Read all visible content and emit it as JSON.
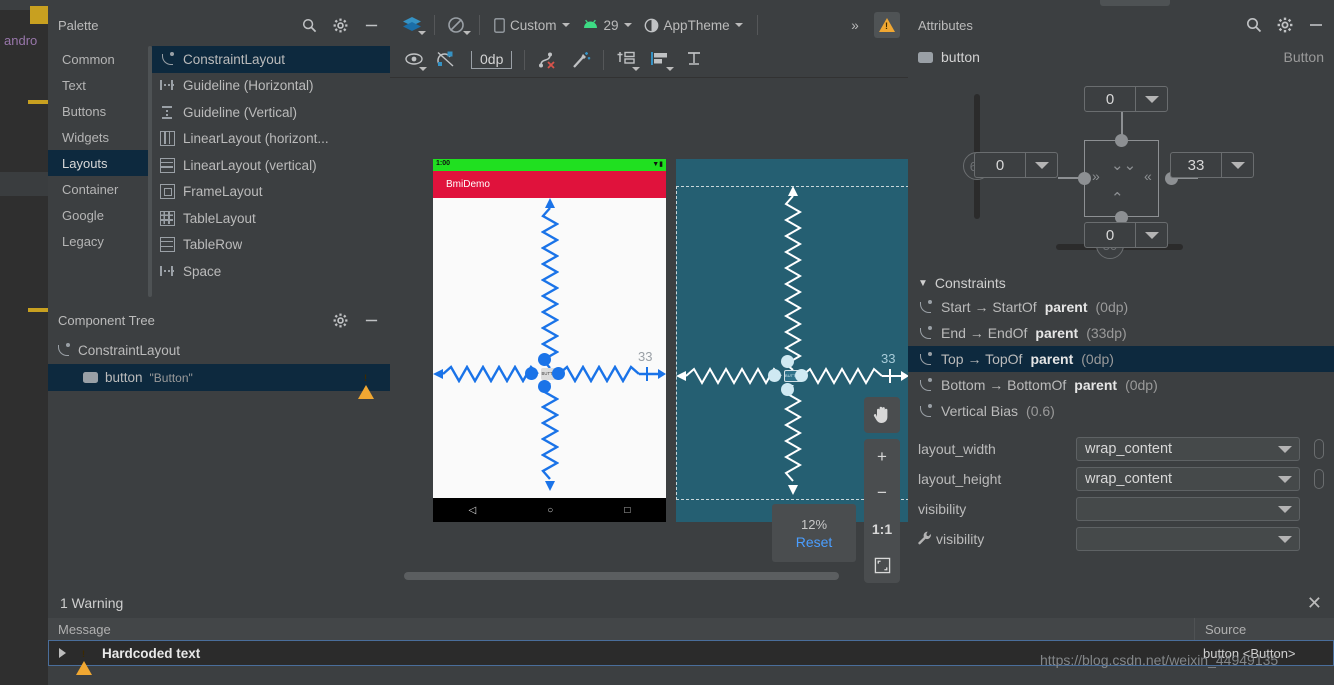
{
  "palette": {
    "title": "Palette",
    "icons": [
      "search-icon",
      "gear-icon",
      "minimize-icon"
    ],
    "categories": [
      {
        "label": "Common",
        "selected": false
      },
      {
        "label": "Text",
        "selected": false
      },
      {
        "label": "Buttons",
        "selected": false
      },
      {
        "label": "Widgets",
        "selected": false
      },
      {
        "label": "Layouts",
        "selected": true
      },
      {
        "label": "Container",
        "selected": false
      },
      {
        "label": "Google",
        "selected": false
      },
      {
        "label": "Legacy",
        "selected": false
      }
    ],
    "items": [
      {
        "label": "ConstraintLayout",
        "icon": "constraint-layout-icon",
        "selected": true
      },
      {
        "label": "Guideline (Horizontal)",
        "icon": "guideline-horizontal-icon",
        "selected": false
      },
      {
        "label": "Guideline (Vertical)",
        "icon": "guideline-vertical-icon",
        "selected": false
      },
      {
        "label": "LinearLayout (horizont...",
        "icon": "linearlayout-horizontal-icon",
        "selected": false
      },
      {
        "label": "LinearLayout (vertical)",
        "icon": "linearlayout-vertical-icon",
        "selected": false
      },
      {
        "label": "FrameLayout",
        "icon": "framelayout-icon",
        "selected": false
      },
      {
        "label": "TableLayout",
        "icon": "tablelayout-icon",
        "selected": false
      },
      {
        "label": "TableRow",
        "icon": "tablerow-icon",
        "selected": false
      },
      {
        "label": "Space",
        "icon": "space-icon",
        "selected": false
      }
    ]
  },
  "component_tree": {
    "title": "Component Tree",
    "nodes": [
      {
        "label": "ConstraintLayout",
        "detail": "",
        "selected": false,
        "warning": false
      },
      {
        "label": "button",
        "detail": "\"Button\"",
        "selected": true,
        "warning": true
      }
    ]
  },
  "design_toolbar": {
    "design_mode_label": "design-surface-mode",
    "orientation_label": "orientation-icon",
    "device": "Custom",
    "api_level": "29",
    "theme": "AppTheme",
    "overflow": "»",
    "warning_count_icon": "warning-icon"
  },
  "constraint_toolbar": {
    "buttons": [
      "show-constraints-icon",
      "autoconnect-icon",
      "default-margin",
      "clear-constraints-icon",
      "infer-constraints-icon",
      "pack-icon",
      "align-icon",
      "guidelines-icon"
    ],
    "default_margin_value": "0dp"
  },
  "canvas": {
    "app_title": "BmiDemo",
    "status_clock": "1:00",
    "status_icons": "▼▮",
    "widget_label": "BUTTON",
    "margin_label_design": "33",
    "margin_label_blueprint": "33",
    "nav_back": "◁",
    "nav_home": "○",
    "nav_recents": "□",
    "zoom_percent": "12%",
    "zoom_reset": "Reset",
    "zoom_buttons": [
      "pan-icon",
      "zoom-in-icon",
      "zoom-out-icon",
      "zoom-actual-icon",
      "zoom-fit-icon"
    ],
    "zoom_in_label": "+",
    "zoom_out_label": "−",
    "zoom_actual_label": "1:1"
  },
  "attributes": {
    "title": "Attributes",
    "icons": [
      "search-icon",
      "gear-icon",
      "minimize-icon"
    ],
    "component_id": "button",
    "component_type": "Button",
    "constraint_widget": {
      "top_margin": "0",
      "start_margin": "0",
      "end_margin": "33",
      "bottom_margin": "0",
      "vertical_bias": "60",
      "horizontal_bias": "50"
    },
    "constraints_section": {
      "label": "Constraints",
      "expanded": true,
      "items": [
        {
          "text_prefix": "Start → StartOf ",
          "target": "parent",
          "value": "(0dp)",
          "selected": false
        },
        {
          "text_prefix": "End → EndOf ",
          "target": "parent",
          "value": "(33dp)",
          "selected": false
        },
        {
          "text_prefix": "Top → TopOf ",
          "target": "parent",
          "value": "(0dp)",
          "selected": true
        },
        {
          "text_prefix": "Bottom → BottomOf ",
          "target": "parent",
          "value": "(0dp)",
          "selected": false
        },
        {
          "text_prefix": "Vertical Bias ",
          "target": "",
          "value": "(0.6)",
          "selected": false
        }
      ]
    },
    "properties": [
      {
        "label": "layout_width",
        "value": "wrap_content",
        "has_pill": true,
        "wrench": false
      },
      {
        "label": "layout_height",
        "value": "wrap_content",
        "has_pill": true,
        "wrench": false
      },
      {
        "label": "visibility",
        "value": "",
        "has_pill": false,
        "wrench": false
      },
      {
        "label": "visibility",
        "value": "",
        "has_pill": false,
        "wrench": true
      }
    ]
  },
  "warnings": {
    "summary": "1 Warning",
    "col_message": "Message",
    "col_source": "Source",
    "rows": [
      {
        "message": "Hardcoded text",
        "source": "button <Button>"
      }
    ],
    "close_label": "✕"
  },
  "background_editor": {
    "keyword": "andro"
  },
  "watermark": "https://blog.csdn.net/weixin_44949135",
  "colors": {
    "panel": "#3c3f41",
    "selection": "#0d293e",
    "accent_blue": "#1a73e8",
    "blueprint_bg": "#255f72",
    "warning": "#f0a732",
    "actionbar": "#e0123c",
    "statusbar": "#20e020",
    "link": "#4a9eff"
  }
}
